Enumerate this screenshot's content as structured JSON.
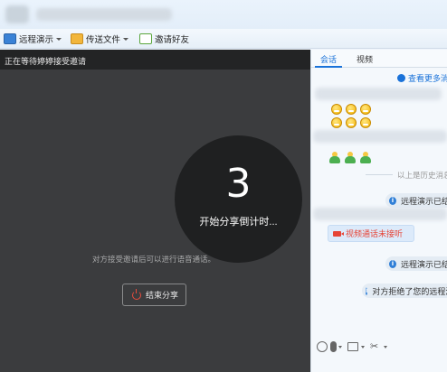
{
  "toolbar": {
    "remote_demo": "远程演示",
    "send_file": "传送文件",
    "invite_friend": "邀请好友"
  },
  "share": {
    "header": "正在等待婷婷接受邀请",
    "count": "3",
    "count_text": "开始分享倒计时...",
    "voice_hint": "对方接受邀请后可以进行语音通话。",
    "end_button": "结束分享"
  },
  "chat": {
    "tabs": [
      "会话",
      "视频"
    ],
    "more_messages": "查看更多消息",
    "history_label": "以上是历史消息",
    "notice_1": "远程演示已结束",
    "missed_call": "视频通话未接听",
    "notice_2": "远程演示已结束",
    "notice_3": "对方拒绝了您的远程演示"
  },
  "colors": {
    "accent": "#1a72d9",
    "share_bg": "#3b3c3e",
    "end_icon": "#e84c3d"
  }
}
